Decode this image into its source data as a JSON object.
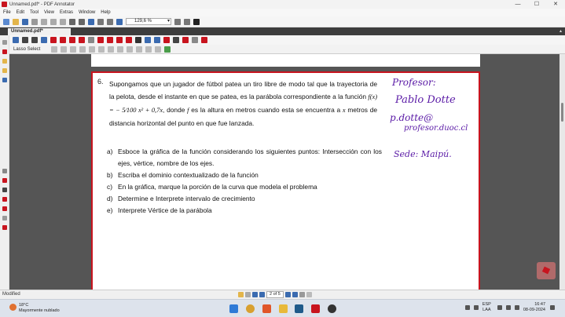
{
  "window": {
    "title": "Unnamed.pdf* - PDF Annotator",
    "controls": [
      "—",
      "☐",
      "✕"
    ]
  },
  "menu": [
    "File",
    "Edit",
    "Tool",
    "View",
    "Extras",
    "Window",
    "Help"
  ],
  "toolbar": {
    "zoom": "129,6 %"
  },
  "tab": {
    "label": "Unnamed.pdf*"
  },
  "tool_label": "Lasso Select",
  "question": {
    "number": "6.",
    "text_a": "Supongamos que un jugador de fútbol patea un tiro libre de modo tal que la trayectoria de la pelota, desde el instante en que se patea, es la parábola correspondiente a la función",
    "formula": "f(x) = − 5⁄100 x² + 0,7x",
    "text_b": ", donde",
    "text_f": "f",
    "text_c": "es la altura en metros cuando esta se encuentra a",
    "text_x": "x",
    "text_d": "metros de distancia horizontal del punto en que fue lanzada.",
    "items": [
      {
        "letter": "a)",
        "text": "Esboce la gráfica de la función considerando los siguientes puntos: Intersección con los ejes, vértice, nombre de los ejes."
      },
      {
        "letter": "b)",
        "text": "Escriba el dominio contextualizado de la función"
      },
      {
        "letter": "c)",
        "text": "En la gráfica, marque la porción de la curva que modela el problema"
      },
      {
        "letter": "d)",
        "text": "Determine e Interprete intervalo de crecimiento"
      },
      {
        "letter": "e)",
        "text": "Interprete Vértice de la parábola"
      }
    ]
  },
  "handwriting": {
    "line1": "Profesor:",
    "line2": "Pablo Dotte",
    "line3": "p.dotte@",
    "line4": "profesor.duoc.cl",
    "line5": "Sede: Maipú."
  },
  "status": {
    "state": "Modified",
    "page": "2 of 5"
  },
  "taskbar": {
    "temperature": "18°C",
    "weather": "Mayormente nublado",
    "lang_top": "ESP",
    "lang_bottom": "LAA",
    "time": "16:47",
    "date": "08-09-2024"
  },
  "colors": {
    "accent": "#c8141e",
    "ink": "#5a1aa6"
  }
}
